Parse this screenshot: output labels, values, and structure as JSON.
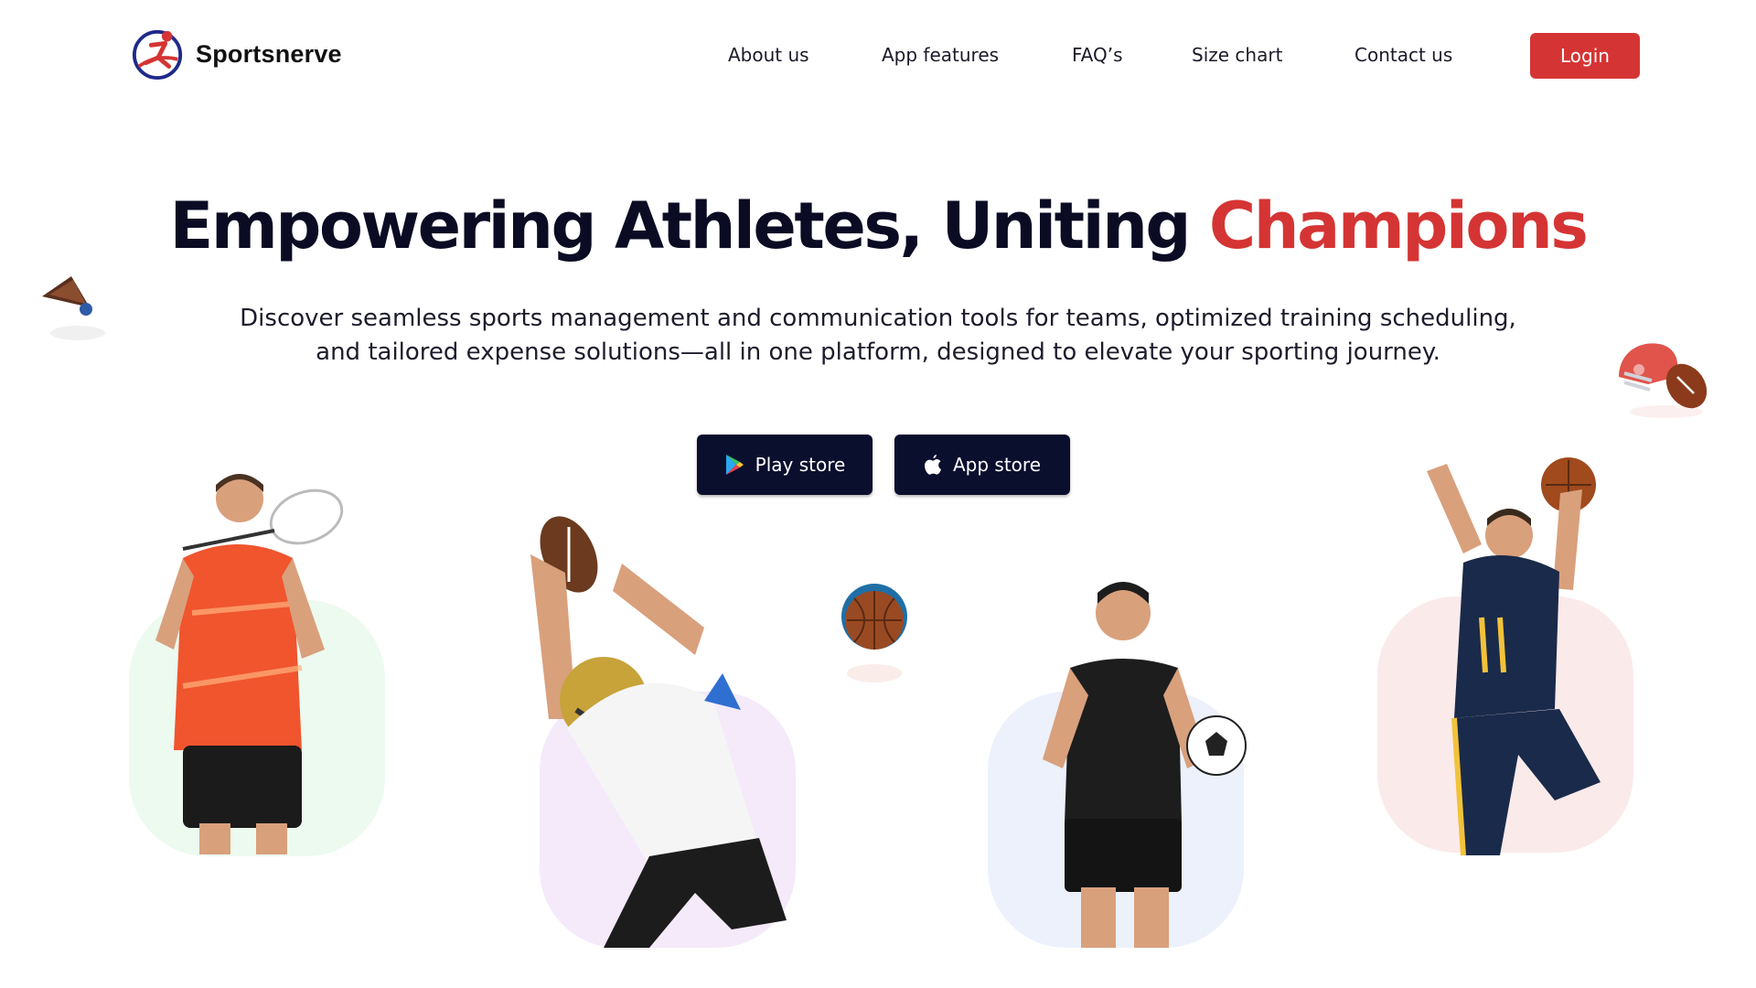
{
  "brand": {
    "name": "Sportsnerve",
    "logo_icon": "runner-logo-icon"
  },
  "nav": {
    "items": [
      {
        "label": "About us"
      },
      {
        "label": "App features"
      },
      {
        "label": "FAQ’s"
      },
      {
        "label": "Size chart"
      },
      {
        "label": "Contact us"
      }
    ],
    "login_label": "Login"
  },
  "hero": {
    "title_main": "Empowering Athletes, Uniting ",
    "title_accent": "Champions",
    "subtitle_line1": "Discover seamless sports management and communication tools for teams, optimized training scheduling,",
    "subtitle_line2": "and tailored expense solutions—all in one platform, designed to elevate your sporting journey.",
    "play_store_label": "Play store",
    "app_store_label": "App store"
  },
  "colors": {
    "accent": "#d53434",
    "dark": "#0b0f2e",
    "card_green": "#ecfaef",
    "card_purple": "#f4eafa",
    "card_blue": "#ecf1fb",
    "card_pink": "#fbeaea"
  },
  "icons": [
    "play-store-icon",
    "apple-icon",
    "shuttlecock-icon",
    "helmet-football-icon",
    "basketball-icon"
  ]
}
